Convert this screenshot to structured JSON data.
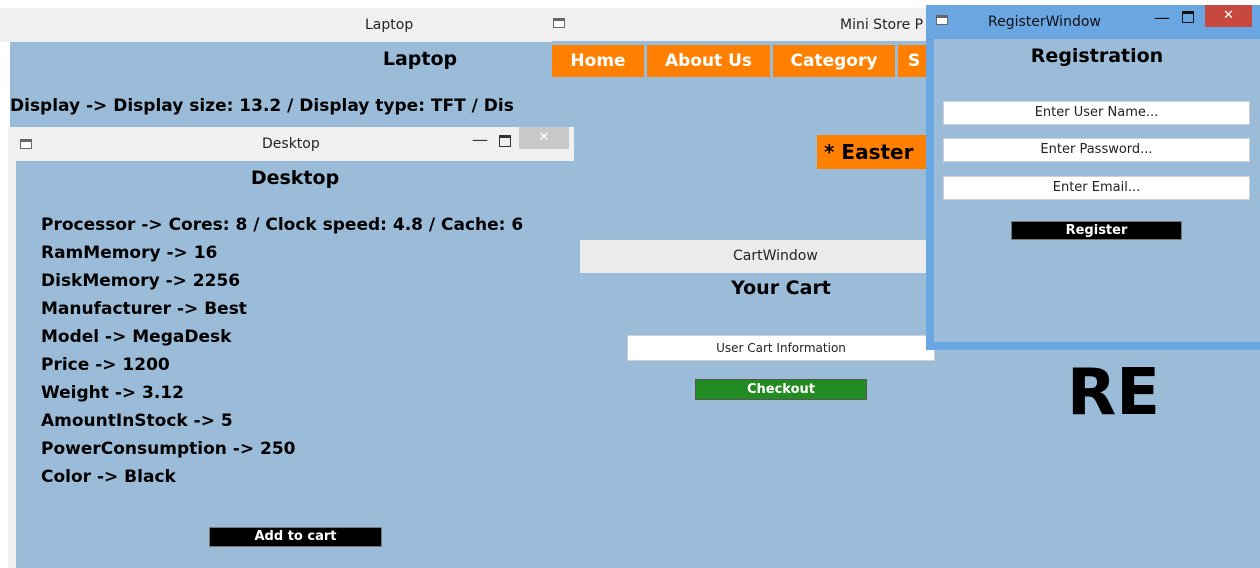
{
  "laptop": {
    "title": "Laptop",
    "heading": "Laptop",
    "display_line": "Display -> Display size: 13.2 / Display type: TFT / Dis"
  },
  "ministore": {
    "title": "Mini Store P",
    "nav": [
      "Home",
      "About Us",
      "Category",
      "S"
    ],
    "banner": "* Easter",
    "big_text": "RE"
  },
  "desktop": {
    "title": "Desktop",
    "heading": "Desktop",
    "props": [
      "Processor -> Cores: 8 / Clock speed: 4.8 / Cache: 6",
      "RamMemory -> 16",
      "DiskMemory -> 2256",
      "Manufacturer -> Best",
      "Model -> MegaDesk",
      "Price -> 1200",
      "Weight -> 3.12",
      "AmountInStock -> 5",
      "PowerConsumption -> 250",
      "Color -> Black"
    ],
    "add_button": "Add to cart"
  },
  "cart": {
    "title": "CartWindow",
    "heading": "Your Cart",
    "info": "User Cart Information",
    "checkout": "Checkout"
  },
  "register": {
    "title": "RegisterWindow",
    "heading": "Registration",
    "username": "Enter User Name...",
    "password": "Enter Password...",
    "email": "Enter Email...",
    "button": "Register"
  },
  "colors": {
    "client_bg": "#9bbcd8",
    "accent_orange": "#ff8000",
    "checkout_green": "#228b22",
    "active_frame": "#6aa6e2",
    "close_red": "#c7483d"
  }
}
